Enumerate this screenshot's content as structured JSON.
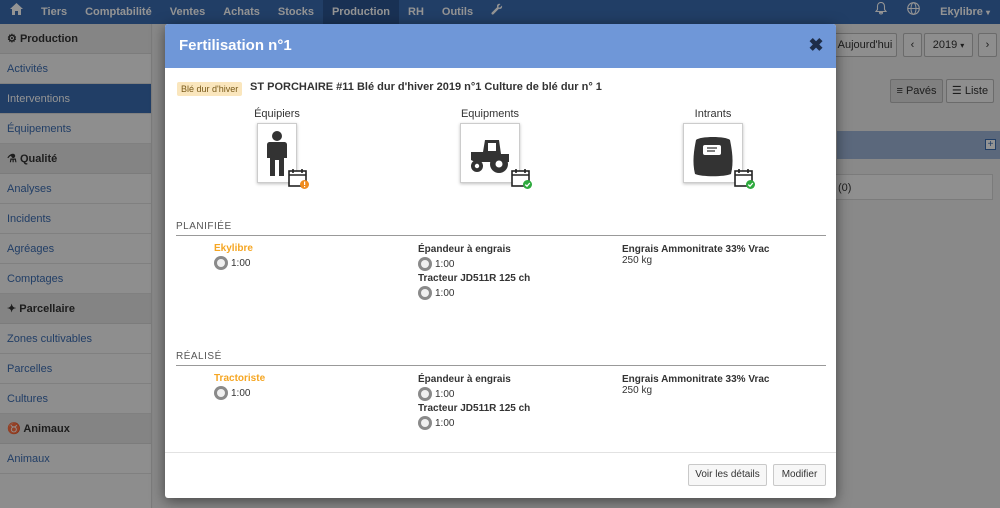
{
  "topnav": {
    "items": [
      "Tiers",
      "Comptabilité",
      "Ventes",
      "Achats",
      "Stocks",
      "Production",
      "RH",
      "Outils"
    ],
    "active": "Production",
    "user": "Ekylibre"
  },
  "sidebar": {
    "sections": [
      {
        "title": "Production",
        "items": [
          "Activités",
          "Interventions",
          "Équipements"
        ]
      },
      {
        "title": "Qualité",
        "items": [
          "Analyses",
          "Incidents",
          "Agréages",
          "Comptages"
        ]
      },
      {
        "title": "Parcellaire",
        "items": [
          "Zones cultivables",
          "Parcelles",
          "Cultures"
        ]
      },
      {
        "title": "Animaux",
        "items": [
          "Animaux"
        ]
      }
    ],
    "active_item": "Interventions"
  },
  "background": {
    "today_button": "Aujourd'hui",
    "year": "2019",
    "view_paves": "Pavés",
    "view_liste": "Liste",
    "count": "(0)"
  },
  "modal": {
    "title": "Fertilisation n°1",
    "crop_badge": "Blé dur d'hiver",
    "intervention_label": "ST PORCHAIRE #11 Blé dur d'hiver 2019 n°1 Culture de blé dur n° 1",
    "categories": {
      "equipiers": "Équipiers",
      "equipments": "Equipments",
      "intrants": "Intrants"
    },
    "planned": {
      "title": "PLANIFIÉE",
      "person": "Ekylibre",
      "person_duration": "1:00",
      "equipment_1": "Épandeur à engrais",
      "equipment_1_duration": "1:00",
      "equipment_2": "Tracteur JD511R 125 ch",
      "equipment_2_duration": "1:00",
      "input_name": "Engrais Ammonitrate 33% Vrac",
      "input_qty": "250 kg"
    },
    "realised": {
      "title": "RÉALISÉ",
      "person": "Tractoriste",
      "person_duration": "1:00",
      "equipment_1": "Épandeur à engrais",
      "equipment_1_duration": "1:00",
      "equipment_2": "Tracteur JD511R 125 ch",
      "equipment_2_duration": "1:00",
      "input_name": "Engrais Ammonitrate 33% Vrac",
      "input_qty": "250 kg"
    },
    "buttons": {
      "details": "Voir les détails",
      "edit": "Modifier"
    }
  },
  "colors": {
    "nav": "#3a6bb0",
    "modal_header": "#6f97d8",
    "person": "#f5a623",
    "check": "#2eaa3e",
    "warning": "#f08c1e"
  }
}
